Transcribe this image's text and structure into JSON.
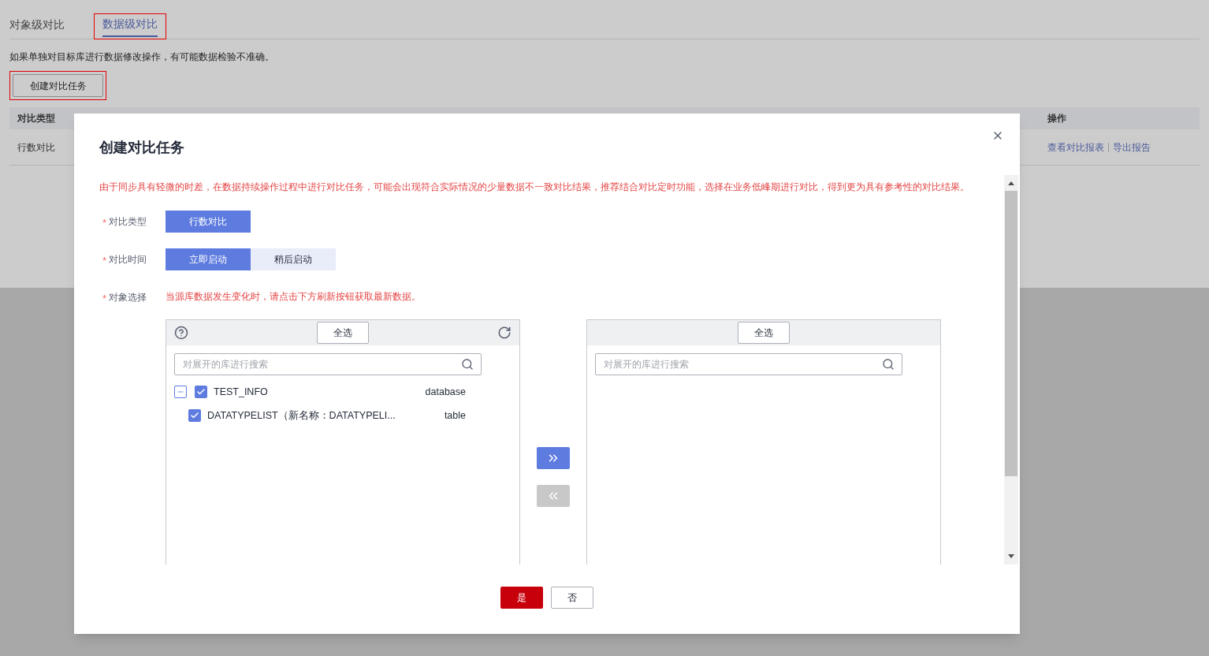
{
  "tabs": [
    {
      "label": "对象级对比",
      "selected": false,
      "highlighted": false
    },
    {
      "label": "数据级对比",
      "selected": true,
      "highlighted": true
    }
  ],
  "notice": "如果单独对目标库进行数据修改操作，有可能数据检验不准确。",
  "create_button": {
    "label": "创建对比任务",
    "highlighted": true
  },
  "table": {
    "columns": [
      "对比类型",
      "操作"
    ],
    "rows": [
      {
        "type": "行数对比",
        "actions": [
          "查看对比报表",
          "导出报告"
        ]
      }
    ]
  },
  "dialog": {
    "title": "创建对比任务",
    "warning": "由于同步具有轻微的时差，在数据持续操作过程中进行对比任务，可能会出现符合实际情况的少量数据不一致对比结果，推荐结合对比定时功能，选择在业务低峰期进行对比，得到更为具有参考性的对比结果。",
    "fields": [
      {
        "kind": "options",
        "label": "对比类型",
        "required_mark": "*",
        "options": [
          {
            "label": "行数对比",
            "selected": true
          }
        ]
      },
      {
        "kind": "options",
        "label": "对比时间",
        "required_mark": "*",
        "options": [
          {
            "label": "立即启动",
            "selected": true
          },
          {
            "label": "稍后启动",
            "selected": false
          }
        ]
      },
      {
        "kind": "transfer",
        "label": "对象选择",
        "required_mark": "*",
        "hint": "当源库数据发生变化时，请点击下方刷新按钮获取最新数据。",
        "source": {
          "select_all": "全选",
          "placeholder": "对展开的库进行搜索",
          "tree": [
            {
              "name": "TEST_INFO",
              "type": "database",
              "checked": true,
              "expanded": true,
              "children": [
                {
                  "name": "DATATYPELIST（新名称：DATATYPELI...",
                  "type": "table",
                  "checked": true
                }
              ]
            }
          ]
        },
        "move_buttons": [
          {
            "kind": "right",
            "disabled": false
          },
          {
            "kind": "left",
            "disabled": true
          }
        ],
        "target": {
          "select_all": "全选",
          "placeholder": "对展开的库进行搜索"
        }
      }
    ],
    "buttons": [
      {
        "kind": "primary",
        "label": "是"
      },
      {
        "kind": "secondary",
        "label": "否"
      }
    ]
  }
}
